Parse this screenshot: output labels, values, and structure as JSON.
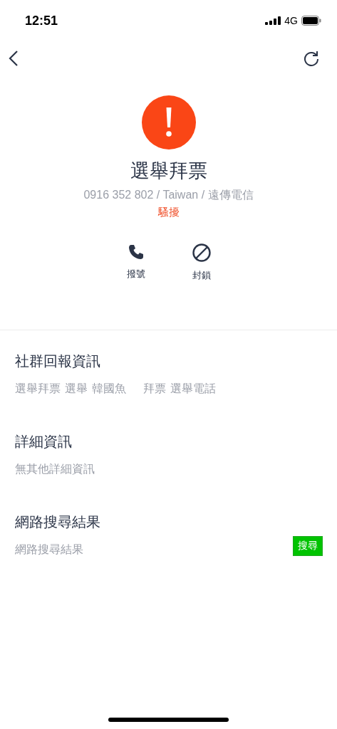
{
  "status_bar": {
    "time": "12:51",
    "network": "4G"
  },
  "caller": {
    "name": "選舉拜票",
    "details": "0916 352 802 / Taiwan / 遠傳電信",
    "category": "騷擾"
  },
  "actions": [
    {
      "kind": "call",
      "label": "撥號"
    },
    {
      "kind": "block",
      "label": "封鎖"
    }
  ],
  "sections": [
    {
      "kind": "tags",
      "title": "社群回報資訊",
      "tags": [
        "選舉拜票",
        "選舉",
        "韓國魚",
        "拜票",
        "選舉電話"
      ]
    },
    {
      "kind": "text",
      "title": "詳細資訊",
      "text": "無其他詳細資訊"
    },
    {
      "kind": "search",
      "title": "網路搜尋結果",
      "text": "網路搜尋結果",
      "button": "搜尋"
    }
  ]
}
